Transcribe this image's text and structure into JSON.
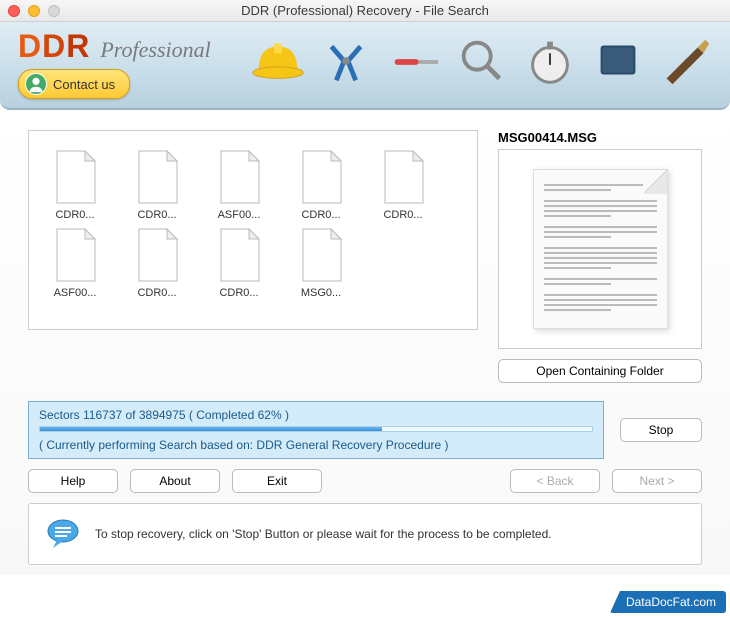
{
  "window": {
    "title": "DDR (Professional) Recovery - File Search"
  },
  "banner": {
    "logo_ddr": "DDR",
    "logo_sub": "Professional",
    "contact_label": "Contact us"
  },
  "files": [
    {
      "name": "CDR0..."
    },
    {
      "name": "CDR0..."
    },
    {
      "name": "ASF00..."
    },
    {
      "name": "CDR0..."
    },
    {
      "name": "CDR0..."
    },
    {
      "name": "ASF00..."
    },
    {
      "name": "CDR0..."
    },
    {
      "name": "CDR0..."
    },
    {
      "name": "MSG0..."
    }
  ],
  "preview": {
    "filename": "MSG00414.MSG",
    "open_folder_label": "Open Containing Folder"
  },
  "progress": {
    "sectors_line": "Sectors 116737 of 3894975    ( Completed 62% )",
    "status_line": "( Currently performing Search based on: DDR General Recovery Procedure )",
    "percent": 62,
    "stop_label": "Stop"
  },
  "nav": {
    "help": "Help",
    "about": "About",
    "exit": "Exit",
    "back": "< Back",
    "next": "Next >"
  },
  "hint": {
    "text": "To stop recovery, click on 'Stop' Button or please wait for the process to be completed."
  },
  "brand": {
    "label": "DataDocFat.com"
  }
}
